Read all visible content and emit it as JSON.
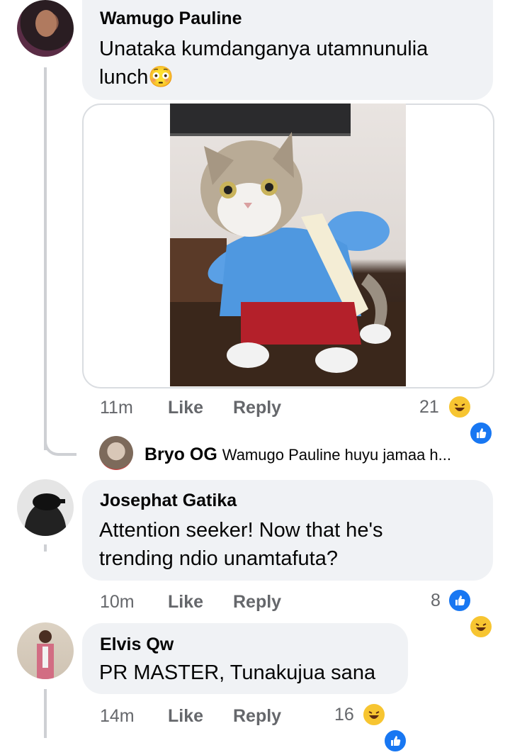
{
  "comments": [
    {
      "author": "Wamugo Pauline",
      "text_line1": "Unataka kumdanganya utamnunulia",
      "text_line2": "lunch😳",
      "time": "11m",
      "like": "Like",
      "reply": "Reply",
      "reaction_count": "21",
      "reactions": [
        "haha-icon",
        "like-icon"
      ]
    },
    {
      "author": "Josephat Gatika",
      "text_line1": "Attention seeker!  Now that he's",
      "text_line2": "trending ndio unamtafuta?",
      "time": "10m",
      "like": "Like",
      "reply": "Reply",
      "reaction_count": "8",
      "reactions": [
        "like-icon",
        "haha-icon"
      ]
    },
    {
      "author": "Elvis Qw",
      "text_line1": "PR MASTER, Tunakujua sana",
      "time": "14m",
      "like": "Like",
      "reply": "Reply",
      "reaction_count": "16",
      "reactions": [
        "haha-icon",
        "like-icon"
      ]
    }
  ],
  "reply_preview": {
    "author": "Bryo OG",
    "text": "Wamugo Pauline huyu jamaa h..."
  },
  "colors": {
    "bubble": "#f0f2f5",
    "like_blue": "#1877f2",
    "haha_yellow": "#f7c531",
    "meta_gray": "#65676b"
  }
}
